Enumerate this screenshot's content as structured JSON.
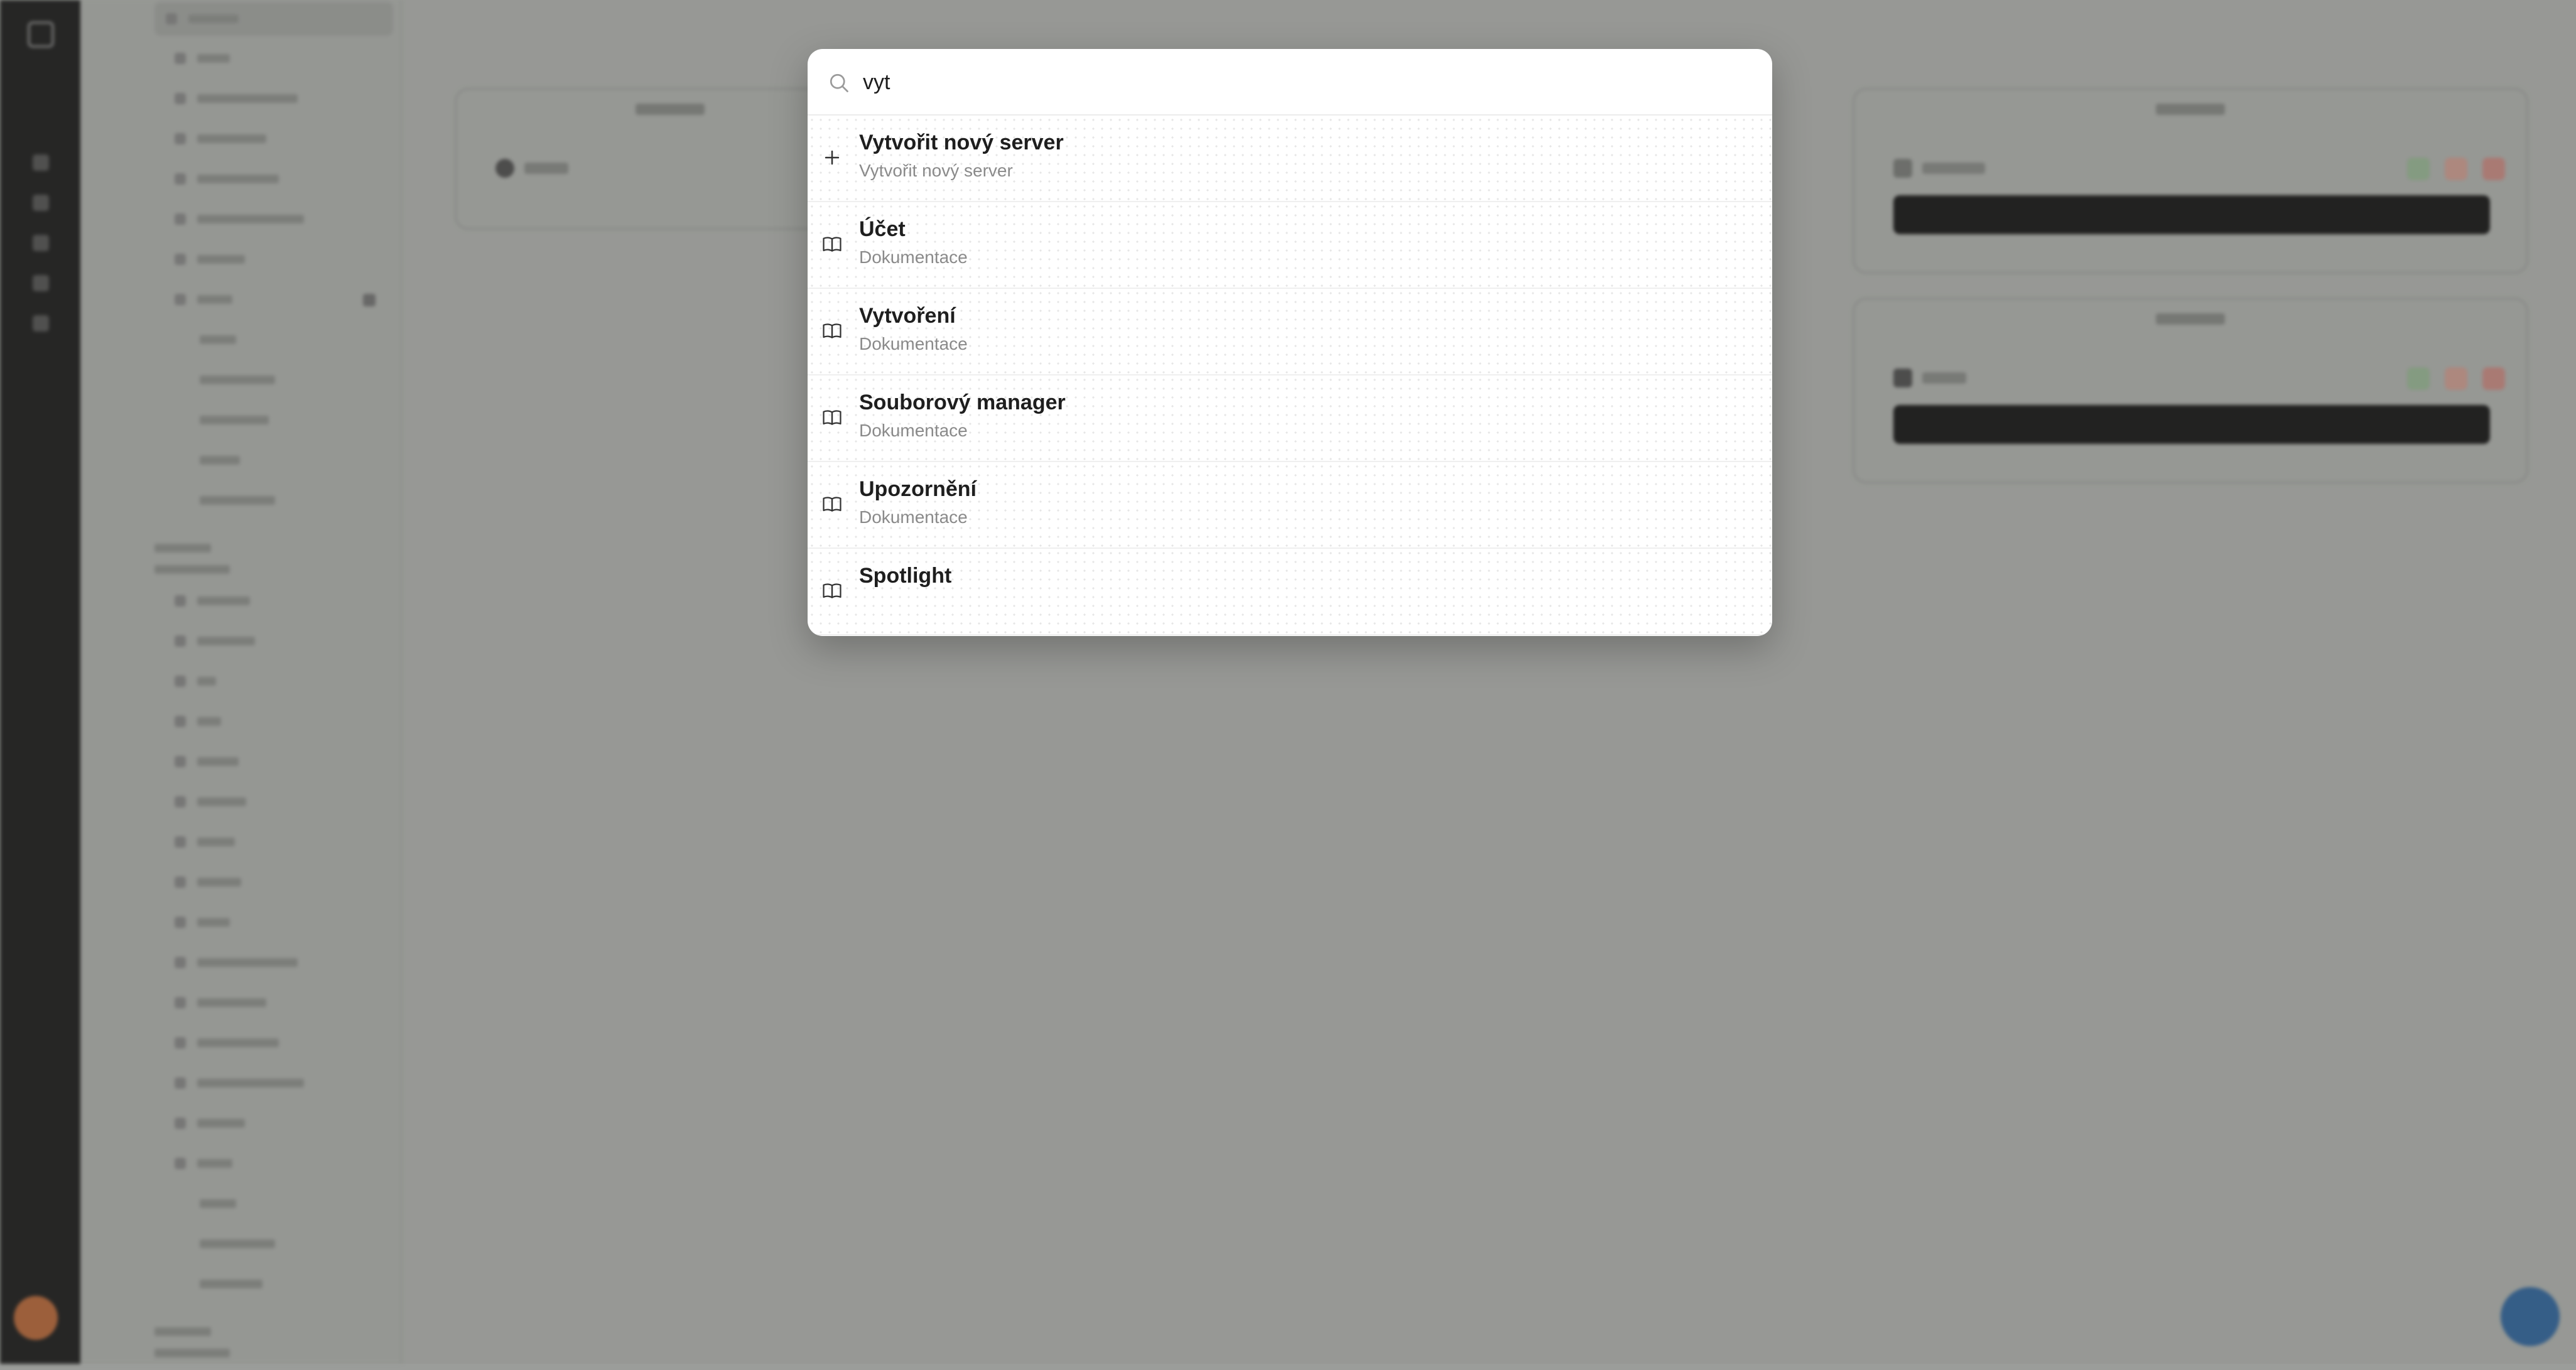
{
  "search": {
    "value": "vyt"
  },
  "results": [
    {
      "icon": "plus-icon",
      "title": "Vytvořit nový server",
      "subtitle": "Vytvořit nový server"
    },
    {
      "icon": "book-icon",
      "title": "Účet",
      "subtitle": "Dokumentace"
    },
    {
      "icon": "book-icon",
      "title": "Vytvoření",
      "subtitle": "Dokumentace"
    },
    {
      "icon": "book-icon",
      "title": "Souborový manager",
      "subtitle": "Dokumentace"
    },
    {
      "icon": "book-icon",
      "title": "Upozornění",
      "subtitle": "Dokumentace"
    },
    {
      "icon": "book-icon",
      "title": "Spotlight",
      "subtitle": ""
    }
  ],
  "colors": {
    "backdrop": "#9b9d9a",
    "rail": "#1b1b1b",
    "palette_bg": "#ffffff",
    "title_text": "#1e1e1e",
    "subtitle_text": "#8a8a8a",
    "fab": "#2c5a8a"
  }
}
